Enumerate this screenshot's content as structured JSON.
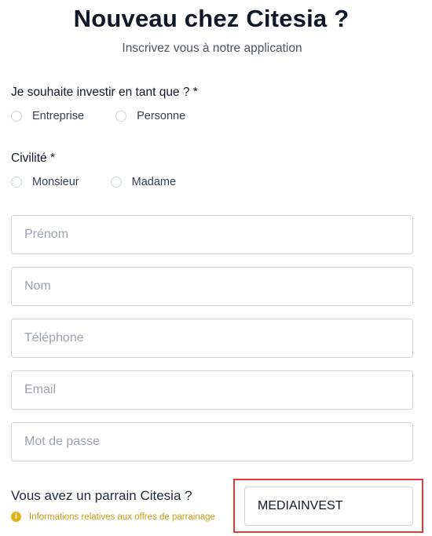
{
  "header": {
    "title": "Nouveau chez Citesia ?",
    "subtitle": "Inscrivez vous à notre application"
  },
  "investor_type": {
    "label": "Je souhaite investir en tant que ? *",
    "options": [
      "Entreprise",
      "Personne"
    ]
  },
  "civility": {
    "label": "Civilité *",
    "options": [
      "Monsieur",
      "Madame"
    ]
  },
  "fields": {
    "prenom": {
      "placeholder": "Prénom",
      "value": ""
    },
    "nom": {
      "placeholder": "Nom",
      "value": ""
    },
    "telephone": {
      "placeholder": "Téléphone",
      "value": ""
    },
    "email": {
      "placeholder": "Email",
      "value": ""
    },
    "password": {
      "placeholder": "Mot de passe",
      "value": ""
    }
  },
  "sponsor": {
    "label": "Vous avez un parrain Citesia ?",
    "info": "Informations relatives aux offres de parrainage",
    "value": "MEDIAINVEST",
    "info_icon": "info-icon"
  },
  "colors": {
    "title": "#0f172a",
    "info": "#c99a12",
    "highlight": "#e53935"
  }
}
